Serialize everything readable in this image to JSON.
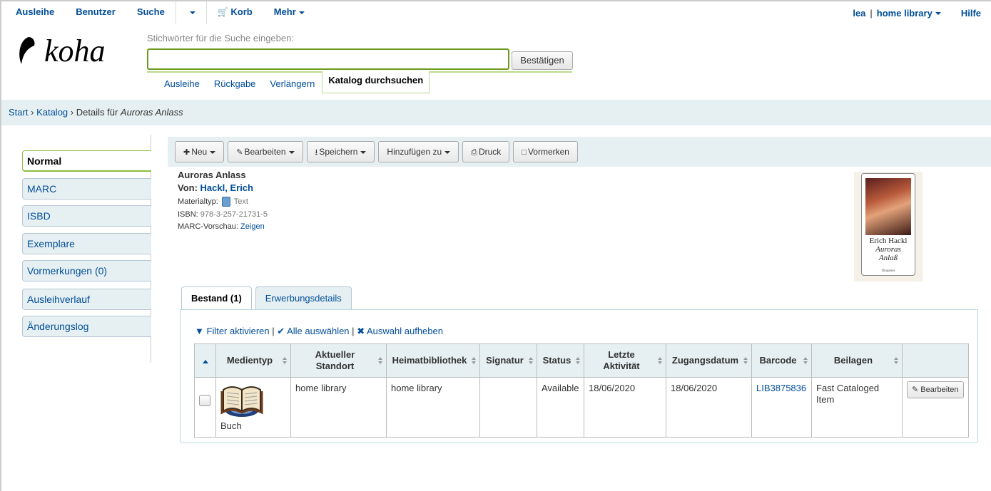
{
  "topnav": {
    "circulation": "Ausleihe",
    "patrons": "Benutzer",
    "search": "Suche",
    "cart": "Korb",
    "more": "Mehr",
    "user": "lea",
    "library": "home library",
    "help": "Hilfe"
  },
  "header": {
    "logo_text": "koha",
    "search_label": "Stichwörter für die Suche eingeben:",
    "search_value": "",
    "submit_label": "Bestätigen",
    "tabs": [
      {
        "label": "Ausleihe"
      },
      {
        "label": "Rückgabe"
      },
      {
        "label": "Verlängern"
      },
      {
        "label": "Katalog durchsuchen"
      }
    ]
  },
  "breadcrumb": {
    "home": "Start",
    "sep": "›",
    "catalog": "Katalog",
    "details_prefix": "Details für",
    "title": "Auroras Anlass"
  },
  "sidebar": {
    "items": [
      {
        "label": "Normal"
      },
      {
        "label": "MARC"
      },
      {
        "label": "ISBD"
      },
      {
        "label": "Exemplare"
      },
      {
        "label": "Vormerkungen (0)"
      },
      {
        "label": "Ausleihverlauf"
      },
      {
        "label": "Änderungslog"
      }
    ]
  },
  "toolbar": {
    "new": "Neu",
    "edit": "Bearbeiten",
    "save": "Speichern",
    "add_to": "Hinzufügen zu",
    "print": "Druck",
    "hold": "Vormerken"
  },
  "record": {
    "title": "Auroras Anlass",
    "by_label": "Von:",
    "author": "Hackl, Erich",
    "material_label": "Materialtyp:",
    "material_value": "Text",
    "isbn_label": "ISBN:",
    "isbn_value": "978-3-257-21731-5",
    "marc_label": "MARC-Vorschau:",
    "marc_link": "Zeigen",
    "cover": {
      "author": "Erich Hackl",
      "title_line1": "Auroras",
      "title_line2": "Anlaß",
      "publisher": "Diogenes"
    }
  },
  "tabs": [
    {
      "label": "Bestand (1)"
    },
    {
      "label": "Erwerbungsdetails"
    }
  ],
  "filters": {
    "activate": "Filter aktivieren",
    "select_all": "Alle auswählen",
    "clear": "Auswahl aufheben",
    "sep": "|"
  },
  "table": {
    "headers": [
      "Medientyp",
      "Aktueller Standort",
      "Heimatbibliothek",
      "Signatur",
      "Status",
      "Letzte Aktivität",
      "Zugangsdatum",
      "Barcode",
      "Beilagen"
    ],
    "rows": [
      {
        "itemtype": "Buch",
        "current_location": "home library",
        "home_library": "home library",
        "callnumber": "",
        "status": "Available",
        "last_seen": "18/06/2020",
        "date_accessioned": "18/06/2020",
        "barcode": "LIB3875836",
        "materials": "Fast Cataloged Item",
        "edit_label": "Bearbeiten"
      }
    ]
  },
  "colors": {
    "link": "#004d99",
    "accent_green": "#8cbf3f",
    "light_bg": "#e6f0f2"
  }
}
